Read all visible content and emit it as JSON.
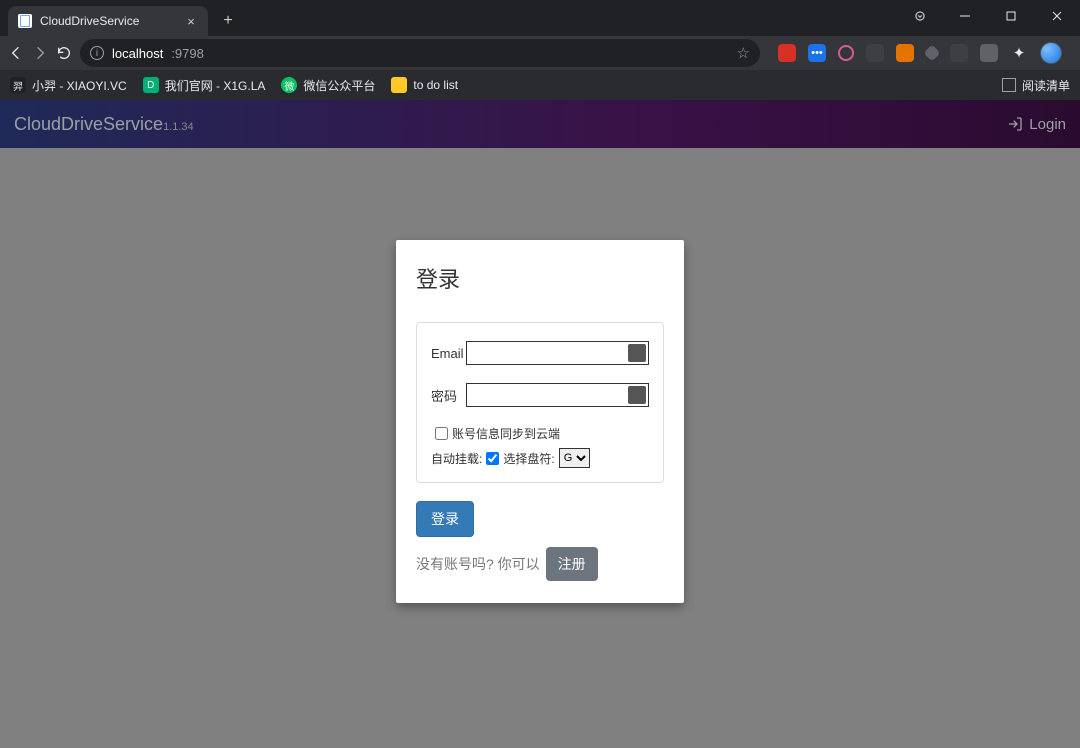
{
  "browser": {
    "tab_title": "CloudDriveService",
    "url_host": "localhost",
    "url_port": ":9798"
  },
  "bookmarks": {
    "items": [
      {
        "label": "小羿 - XIAOYI.VC"
      },
      {
        "label": "我们官网 - X1G.LA"
      },
      {
        "label": "微信公众平台"
      },
      {
        "label": "to do list"
      }
    ],
    "reading_list": "阅读清单"
  },
  "header": {
    "brand": "CloudDriveService",
    "version": "1.1.34",
    "login": "Login"
  },
  "form": {
    "title": "登录",
    "email_label": "Email",
    "password_label": "密码",
    "sync_label": "账号信息同步到云端",
    "auto_mount_label": "自动挂载:",
    "auto_mount_checked": true,
    "drive_label": "选择盘符:",
    "drive_value": "G",
    "submit": "登录",
    "no_account_prefix": "没有账号吗? 你可以",
    "register": "注册"
  }
}
